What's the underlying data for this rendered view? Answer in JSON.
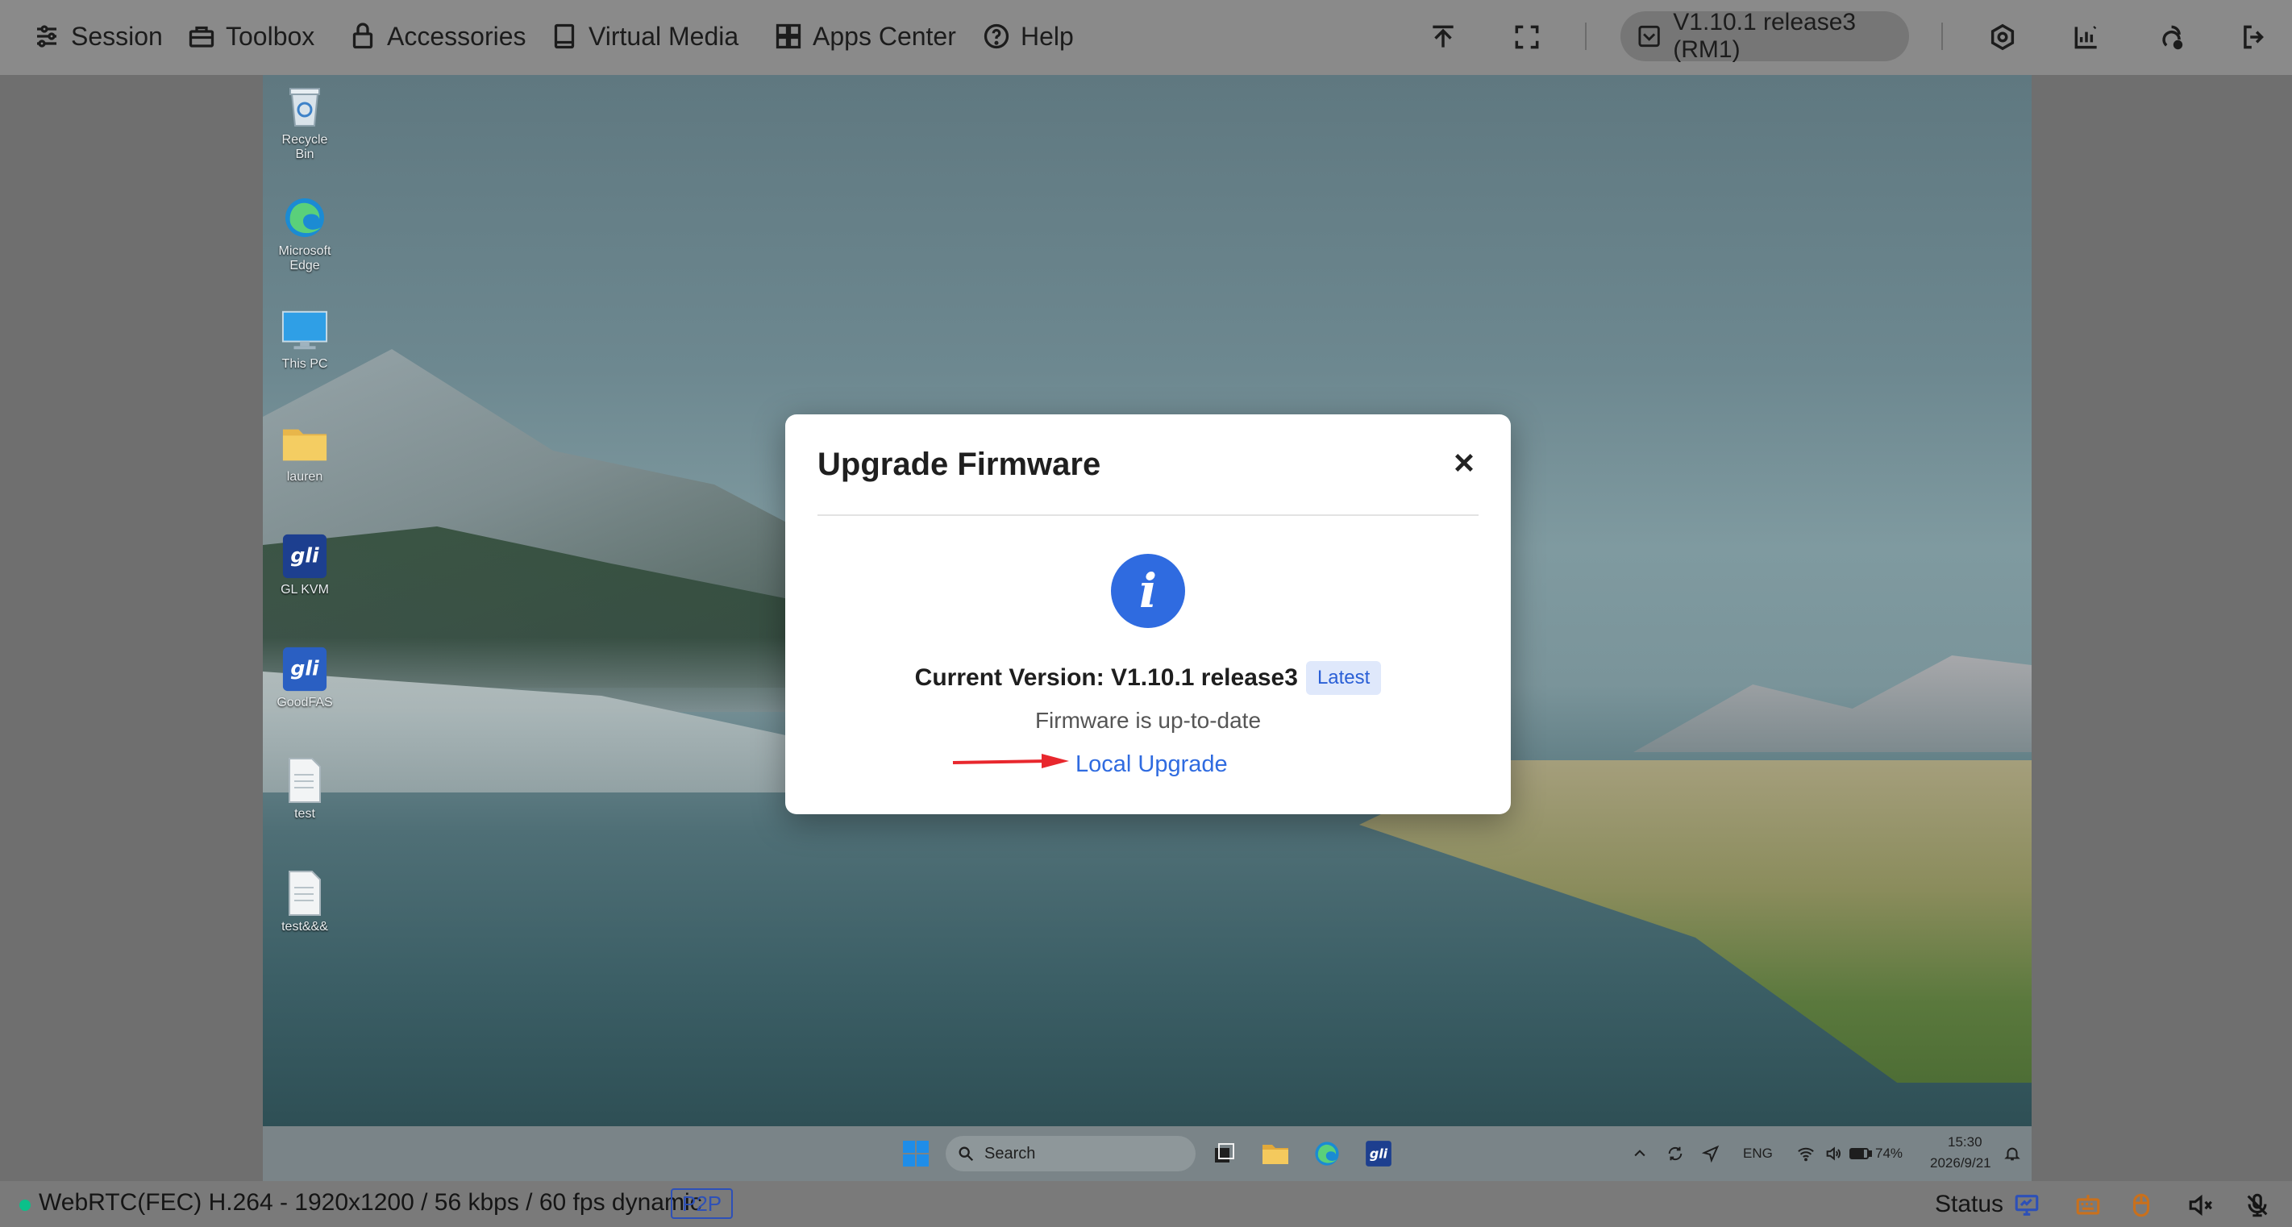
{
  "toolbar": {
    "items": [
      {
        "label": "Session",
        "icon": "session-icon"
      },
      {
        "label": "Toolbox",
        "icon": "toolbox-icon"
      },
      {
        "label": "Accessories",
        "icon": "lock-icon"
      },
      {
        "label": "Virtual Media",
        "icon": "virtual-media-icon"
      },
      {
        "label": "Apps Center",
        "icon": "apps-icon"
      },
      {
        "label": "Help",
        "icon": "help-icon"
      }
    ],
    "version_label": "V1.10.1 release3 (RM1)"
  },
  "desktop": {
    "icons": [
      {
        "label": "Recycle Bin",
        "icon": "recycle-bin-icon"
      },
      {
        "label": "Microsoft Edge",
        "icon": "edge-icon"
      },
      {
        "label": "This PC",
        "icon": "monitor-icon"
      },
      {
        "label": "lauren",
        "icon": "folder-icon"
      },
      {
        "label": "GL KVM",
        "icon": "glinet-icon"
      },
      {
        "label": "GoodFAS",
        "icon": "glinet-icon"
      },
      {
        "label": "test",
        "icon": "document-icon"
      },
      {
        "label": "test&&&",
        "icon": "document-icon"
      }
    ],
    "taskbar": {
      "search_placeholder": "Search",
      "lang": "ENG",
      "battery": "74%",
      "time": "15:30",
      "date": "2026/9/21"
    }
  },
  "modal": {
    "title": "Upgrade Firmware",
    "current_version_label": "Current Version: V1.10.1 release3",
    "badge": "Latest",
    "status": "Firmware is up-to-date",
    "local_upgrade": "Local Upgrade",
    "accent_color": "#2f6be0"
  },
  "statusbar": {
    "stream_info": "WebRTC(FEC) H.264 - 1920x1200  /  56 kbps / 60 fps dynamic",
    "p2p": "P2P",
    "status_label": "Status"
  }
}
